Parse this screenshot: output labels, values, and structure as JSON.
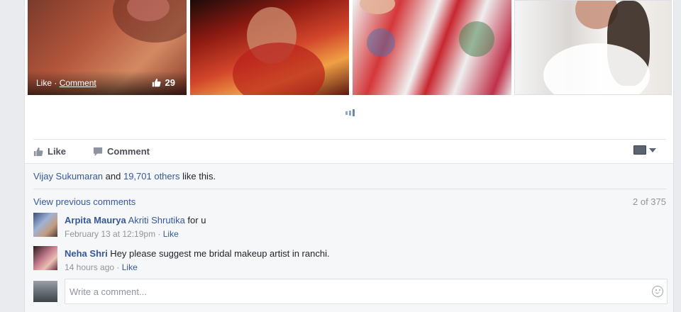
{
  "photo_overlay": {
    "like_label": "Like",
    "separator": " · ",
    "comment_label": "Comment",
    "like_count": "29"
  },
  "actions": {
    "like_label": "Like",
    "comment_label": "Comment"
  },
  "likes_summary": {
    "first_name": "Vijay Sukumaran",
    "connector": " and ",
    "others": "19,701 others",
    "suffix": " like this."
  },
  "comments_header": {
    "view_previous": "View previous comments",
    "count": "2 of 375"
  },
  "comments": [
    {
      "author": "Arpita Maurya",
      "mention": "Akriti Shrutika",
      "text": " for u",
      "timestamp": "February 13 at 12:19pm",
      "separator": " · ",
      "like_label": "Like"
    },
    {
      "author": "Neha Shri",
      "text": " Hey please suggest me bridal makeup artist in ranchi.",
      "timestamp": "14 hours ago",
      "separator": " · ",
      "like_label": "Like"
    }
  ],
  "composer": {
    "placeholder": "Write a comment..."
  },
  "icons": {
    "like": "thumbs-up-icon",
    "comment": "speech-bubble-icon",
    "audience": "audience-selector-icon",
    "emoji": "smiley-icon"
  },
  "colors": {
    "link": "#365899",
    "meta": "#90949c",
    "ufi_background": "#f6f7f9"
  }
}
